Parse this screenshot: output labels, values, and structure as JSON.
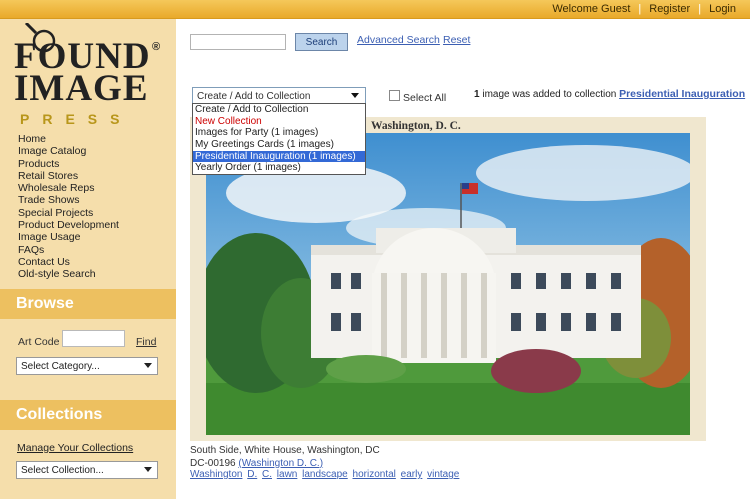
{
  "topbar": {
    "welcome": "Welcome Guest",
    "register": "Register",
    "login": "Login"
  },
  "logo": {
    "found": "FOUND",
    "image": "IMAGE",
    "press": "PRESS",
    "reg": "®"
  },
  "nav": [
    "Home",
    "Image Catalog",
    "Products",
    "Retail Stores",
    "Wholesale Reps",
    "Trade Shows",
    "Special Projects",
    "Product Development",
    "Image Usage",
    "FAQs",
    "Contact Us",
    "Old-style Search"
  ],
  "browse": {
    "heading": "Browse",
    "artcode_label": "Art Code",
    "find": "Find",
    "category_select": "Select Category..."
  },
  "collections": {
    "heading": "Collections",
    "manage": "Manage Your Collections",
    "collection_select": "Select Collection..."
  },
  "search": {
    "button": "Search",
    "advanced": "Advanced Search",
    "reset": "Reset"
  },
  "collection_dropdown": {
    "selected": "Create / Add to Collection",
    "options": [
      "Create / Add to Collection",
      "New Collection",
      "Images for Party (1 images)",
      "My Greetings Cards (1 images)",
      "Presidential Inauguration (1 images)",
      "Yearly Order (1 images)"
    ]
  },
  "select_all": "Select All",
  "notice": {
    "count": "1",
    "text": " image was added to collection ",
    "collection": "Presidential Inauguration"
  },
  "image": {
    "card_title": "Washington, D. C.",
    "title": "South Side, White House, Washington, DC",
    "code": "DC-00196",
    "location": "(Washington D. C.)",
    "tags": [
      "Washington",
      "D.",
      "C.",
      "lawn",
      "landscape",
      "horizontal",
      "early",
      "vintage"
    ]
  },
  "colors": {
    "topbar": "#e9a92a",
    "sidebar": "#f5deab",
    "section_header": "#edc060",
    "link": "#3c5fb3",
    "highlight": "#3369d6"
  }
}
